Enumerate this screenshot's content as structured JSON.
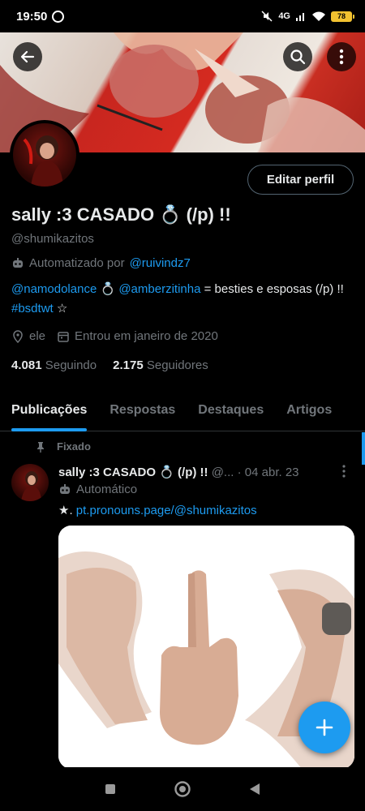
{
  "status_bar": {
    "time": "19:50",
    "network": "4G",
    "battery": "78"
  },
  "profile": {
    "display_name": "sally :3 CASADO 💍 (/p) !!",
    "handle": "@shumikazitos",
    "automated_prefix": "Automatizado por",
    "automated_by": "@ruivindz7",
    "bio_mention_1": "@namodolance",
    "bio_ring": "💍",
    "bio_mention_2": "@amberzitinha",
    "bio_text_1": "= besties e esposas (/p) !!",
    "bio_hashtag": "#bsdtwt",
    "bio_star": "☆",
    "location": "ele",
    "joined": "Entrou em janeiro de 2020",
    "following_count": "4.081",
    "following_label": "Seguindo",
    "followers_count": "2.175",
    "followers_label": "Seguidores",
    "edit_button": "Editar perfil"
  },
  "tabs": [
    {
      "label": "Publicações",
      "active": true
    },
    {
      "label": "Respostas",
      "active": false
    },
    {
      "label": "Destaques",
      "active": false
    },
    {
      "label": "Artigos",
      "active": false
    }
  ],
  "pinned_post": {
    "pinned_label": "Fixado",
    "author_name": "sally :3 CASADO 💍 (/p) !!",
    "author_handle": "@...",
    "separator": "·",
    "date": "04 abr. 23",
    "automated_label": "Automático",
    "text_prefix": "★.",
    "text_link": "pt.pronouns.page/@shumikazitos"
  },
  "colors": {
    "accent": "#1d9bf0",
    "background": "#000000",
    "text_primary": "#e7e9ea",
    "text_secondary": "#71767b"
  },
  "icons": [
    "back-arrow-icon",
    "search-icon",
    "more-vertical-icon",
    "robot-icon",
    "location-icon",
    "calendar-icon",
    "pin-icon",
    "plus-icon"
  ]
}
